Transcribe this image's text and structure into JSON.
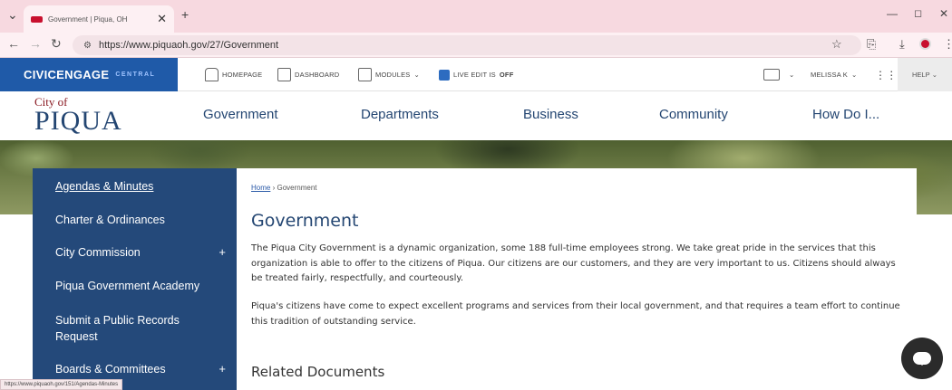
{
  "browser": {
    "tab_title": "Government | Piqua, OH",
    "url": "https://www.piquaoh.gov/27/Government",
    "status_url": "https://www.piquaoh.gov/151/Agendas-Minutes"
  },
  "civic_bar": {
    "brand": "CIVICENGAGE",
    "brand_sub": "CENTRAL",
    "homepage": "HOMEPAGE",
    "dashboard": "DASHBOARD",
    "modules": "MODULES",
    "live_edit": "LIVE EDIT IS",
    "live_edit_state": "OFF",
    "user": "MELISSA K",
    "help": "HELP"
  },
  "site": {
    "logo_city": "City of",
    "logo_name": "PIQUA",
    "nav": [
      "Government",
      "Departments",
      "Business",
      "Community",
      "How Do I..."
    ]
  },
  "sidebar": {
    "items": [
      {
        "label": "Agendas & Minutes",
        "expandable": false
      },
      {
        "label": "Charter & Ordinances",
        "expandable": false
      },
      {
        "label": "City Commission",
        "expandable": true
      },
      {
        "label": "Piqua Government Academy",
        "expandable": false
      },
      {
        "label": "Submit a Public Records Request",
        "expandable": false
      },
      {
        "label": "Boards & Committees",
        "expandable": true
      }
    ],
    "plus": "+"
  },
  "content": {
    "breadcrumb_home": "Home",
    "breadcrumb_sep": "›",
    "breadcrumb_current": "Government",
    "title": "Government",
    "paragraphs": [
      "The Piqua City Government is a dynamic organization, some 188 full-time employees strong. We take great pride in the services that this organization is able to offer to the citizens of Piqua. Our citizens are our customers, and they are very important to us. Citizens should always be treated fairly, respectfully, and courteously.",
      "Piqua's citizens have come to expect excellent programs and services from their local government, and that requires a team effort to continue this tradition of outstanding service."
    ],
    "related_heading": "Related Documents"
  },
  "colors": {
    "civic_blue": "#1f5aa8",
    "sidebar_navy": "#24497a",
    "heading_blue": "#244672"
  }
}
